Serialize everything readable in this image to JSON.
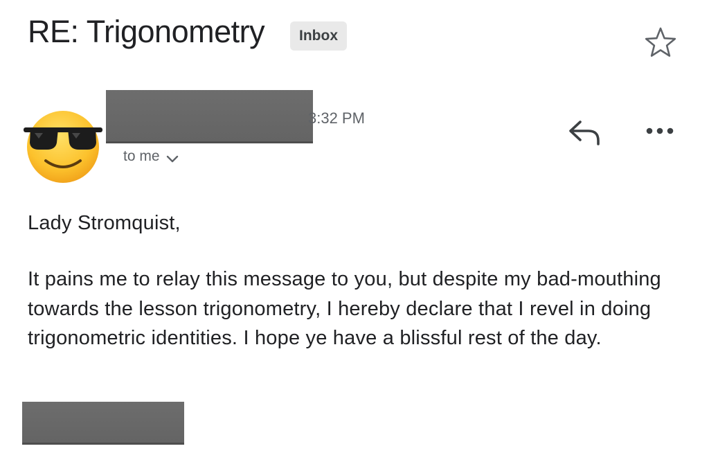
{
  "email": {
    "subject": "RE: Trigonometry",
    "label": "Inbox",
    "time": "3:32 PM",
    "recipient_line": "to me",
    "greeting": "Lady Stromquist,",
    "body": "It pains me to relay this message to you, but despite my bad-mouthing towards the lesson trigonometry, I hereby declare that I revel in doing trigonometric identities. I hope ye have a blissful rest of the day."
  },
  "icons": {
    "star": "star-outline-icon",
    "reply": "reply-arrow-icon",
    "more": "more-horizontal-icon",
    "chevron": "chevron-down-icon",
    "avatar": "sunglasses-emoji-avatar"
  },
  "colors": {
    "text_primary": "#202124",
    "text_secondary": "#5f6368",
    "chip_background": "#e9e9e9",
    "redaction": "#666666",
    "icon": "#5f6368"
  }
}
